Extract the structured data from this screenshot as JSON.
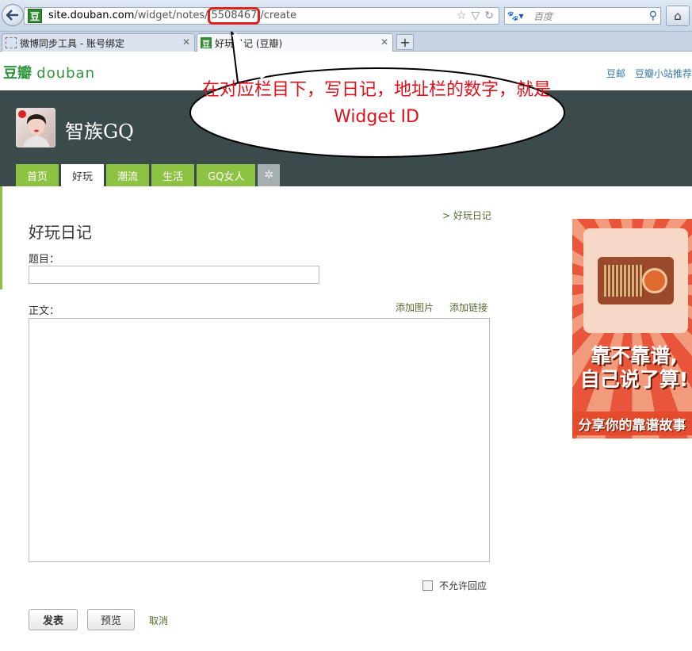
{
  "browser": {
    "url": {
      "host": "site.douban.com",
      "path_before": "/widget/notes/",
      "highlight": "5508467",
      "path_after": "/create"
    },
    "search_placeholder": "百度",
    "tabs": [
      {
        "label": "微博同步工具 - 账号绑定",
        "icon": "dashed-page-icon"
      },
      {
        "label": "好玩日记 (豆瓣)",
        "icon": "douban-favicon"
      }
    ],
    "favicon_char": "豆"
  },
  "douban_nav": {
    "logo_cn": "豆瓣",
    "logo_en": "douban",
    "links": [
      "豆邮",
      "豆瓣小站推荐"
    ]
  },
  "site": {
    "title": "智族GQ",
    "tabs": [
      {
        "label": "首页",
        "active": false
      },
      {
        "label": "好玩",
        "active": true
      },
      {
        "label": "潮流",
        "active": false
      },
      {
        "label": "生活",
        "active": false
      },
      {
        "label": "GQ女人",
        "active": false
      }
    ]
  },
  "form": {
    "crumb_link": "> 好玩日记",
    "page_title": "好玩日记",
    "title_label": "题目：",
    "body_label": "正文：",
    "add_image": "添加图片",
    "add_link": "添加链接",
    "no_reply_label": "不允许回应",
    "publish_label": "发表",
    "preview_label": "预览",
    "cancel_label": "取消"
  },
  "ad": {
    "headline_line1": "靠不靠谱,",
    "headline_line2": "自己说了算!",
    "subline": "分享你的靠谱故事"
  },
  "annotation": {
    "text": "在对应栏目下，写日记，地址栏的数字，就是Widget ID",
    "color": "#e0101a"
  }
}
